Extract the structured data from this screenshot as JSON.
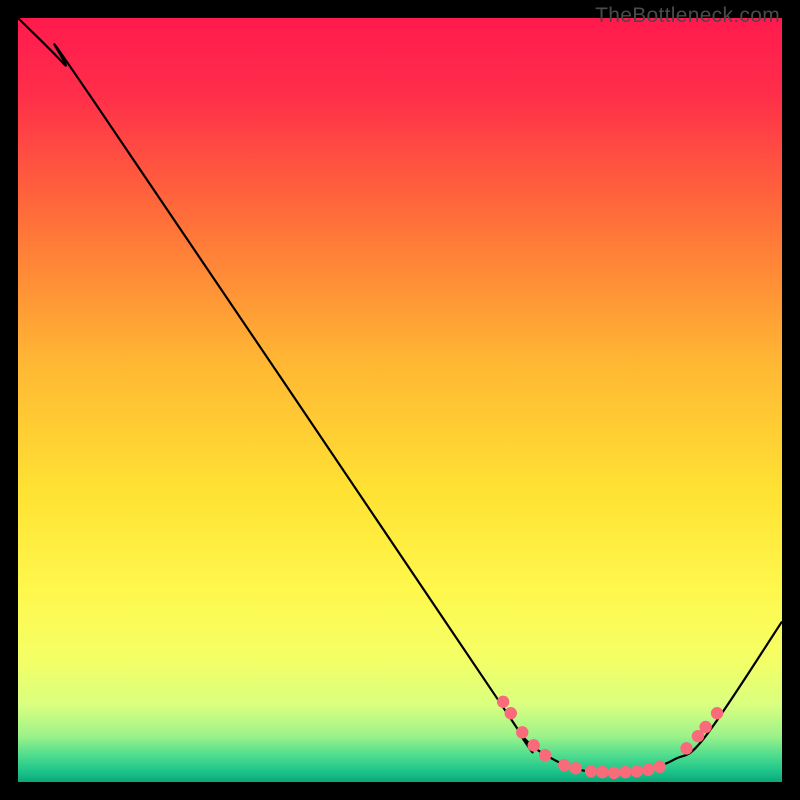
{
  "watermark": "TheBottleneck.com",
  "chart_data": {
    "type": "line",
    "xlim": [
      0,
      100
    ],
    "ylim": [
      0,
      100
    ],
    "title": "",
    "xlabel": "",
    "ylabel": "",
    "curve": [
      {
        "x": 0,
        "y": 100
      },
      {
        "x": 6,
        "y": 94
      },
      {
        "x": 10,
        "y": 89
      },
      {
        "x": 62,
        "y": 12
      },
      {
        "x": 66,
        "y": 6
      },
      {
        "x": 70,
        "y": 3
      },
      {
        "x": 74,
        "y": 1.5
      },
      {
        "x": 78,
        "y": 1.2
      },
      {
        "x": 82,
        "y": 1.5
      },
      {
        "x": 86,
        "y": 3
      },
      {
        "x": 90,
        "y": 6
      },
      {
        "x": 100,
        "y": 21
      }
    ],
    "dots": [
      {
        "x": 63.5,
        "y": 10.5
      },
      {
        "x": 64.5,
        "y": 9.0
      },
      {
        "x": 66.0,
        "y": 6.5
      },
      {
        "x": 67.5,
        "y": 4.8
      },
      {
        "x": 69.0,
        "y": 3.5
      },
      {
        "x": 71.5,
        "y": 2.2
      },
      {
        "x": 73.0,
        "y": 1.8
      },
      {
        "x": 75.0,
        "y": 1.4
      },
      {
        "x": 76.5,
        "y": 1.3
      },
      {
        "x": 78.0,
        "y": 1.2
      },
      {
        "x": 79.5,
        "y": 1.3
      },
      {
        "x": 81.0,
        "y": 1.4
      },
      {
        "x": 82.5,
        "y": 1.6
      },
      {
        "x": 84.0,
        "y": 2.0
      },
      {
        "x": 87.5,
        "y": 4.4
      },
      {
        "x": 89.0,
        "y": 6.0
      },
      {
        "x": 90.0,
        "y": 7.2
      },
      {
        "x": 91.5,
        "y": 9.0
      }
    ],
    "background_gradient": [
      {
        "stop": 0.0,
        "color": "#ff1a4d"
      },
      {
        "stop": 0.1,
        "color": "#ff2e4a"
      },
      {
        "stop": 0.25,
        "color": "#ff6a3a"
      },
      {
        "stop": 0.45,
        "color": "#ffb733"
      },
      {
        "stop": 0.62,
        "color": "#ffe233"
      },
      {
        "stop": 0.75,
        "color": "#fff84d"
      },
      {
        "stop": 0.84,
        "color": "#f4ff66"
      },
      {
        "stop": 0.9,
        "color": "#d9ff80"
      },
      {
        "stop": 0.94,
        "color": "#9cf28a"
      },
      {
        "stop": 0.965,
        "color": "#4fdd8e"
      },
      {
        "stop": 0.985,
        "color": "#1fc58b"
      },
      {
        "stop": 1.0,
        "color": "#0aa878"
      }
    ],
    "dot_color": "#f96a7a",
    "curve_color": "#000000"
  }
}
